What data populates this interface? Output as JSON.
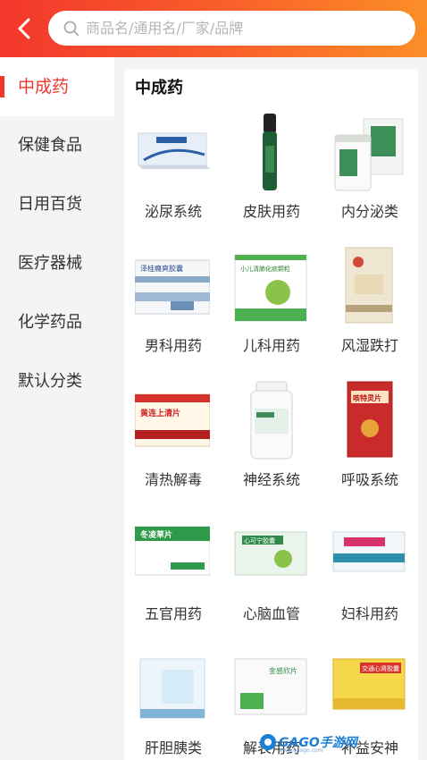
{
  "header": {
    "search_placeholder": "商品名/通用名/厂家/品牌"
  },
  "sidebar": {
    "items": [
      {
        "label": "中成药",
        "active": true
      },
      {
        "label": "保健食品"
      },
      {
        "label": "日用百货"
      },
      {
        "label": "医疗器械"
      },
      {
        "label": "化学药品"
      },
      {
        "label": "默认分类"
      }
    ]
  },
  "panel": {
    "title": "中成药",
    "categories": [
      {
        "label": "泌尿系统"
      },
      {
        "label": "皮肤用药"
      },
      {
        "label": "内分泌类"
      },
      {
        "label": "男科用药"
      },
      {
        "label": "儿科用药"
      },
      {
        "label": "风湿跌打"
      },
      {
        "label": "清热解毒"
      },
      {
        "label": "神经系统"
      },
      {
        "label": "呼吸系统"
      },
      {
        "label": "五官用药"
      },
      {
        "label": "心脑血管"
      },
      {
        "label": "妇科用药"
      },
      {
        "label": "肝胆胰类"
      },
      {
        "label": "解表用药"
      },
      {
        "label": "补益安神"
      }
    ],
    "product_box_text": {
      "p4": "泽桂癃爽胶囊",
      "p5": "小儿清肺化痰颗粒",
      "p7": "黄连上清片",
      "p9": "咳特灵片",
      "p10": "冬凌草片",
      "p11": "心可宁胶囊",
      "p14": "金感欣片",
      "p15": "交通心肾胶囊"
    }
  },
  "watermark": {
    "text": "GAGO手游网",
    "sub": "www.gaogo.com"
  },
  "colors": {
    "accent": "#f2362c",
    "header_end": "#fb8e27"
  }
}
